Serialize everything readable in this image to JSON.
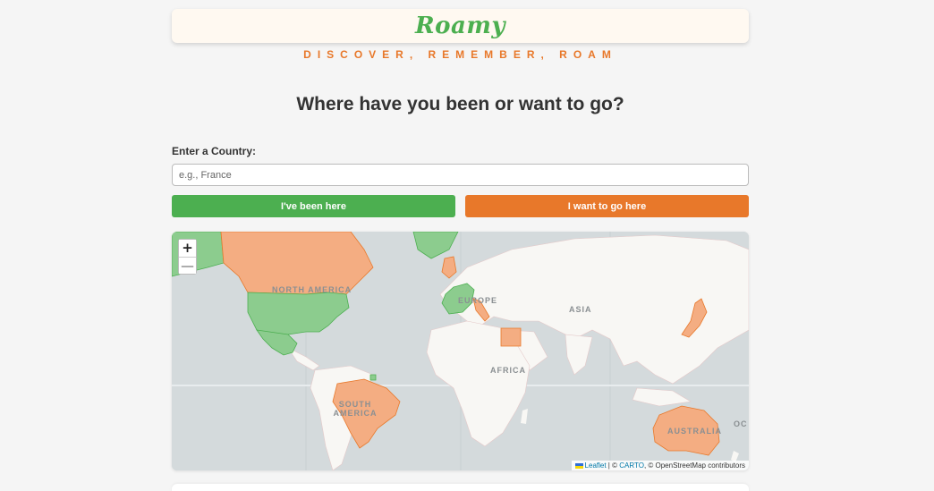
{
  "header": {
    "logo": "Roamy",
    "tagline": "DISCOVER, REMEMBER, ROAM"
  },
  "main": {
    "heading": "Where have you been or want to go?",
    "country_label": "Enter a Country:",
    "country_placeholder": "e.g., France",
    "country_value": "",
    "been_button": "I've been here",
    "want_button": "I want to go here"
  },
  "map": {
    "zoom_in": "+",
    "zoom_out": "—",
    "labels": {
      "north_america": "NORTH AMERICA",
      "europe": "EUROPE",
      "asia": "ASIA",
      "africa": "AFRICA",
      "south_america": "SOUTH AMERICA",
      "australia": "AUSTRALIA",
      "oceania_partial": "OC"
    },
    "attribution": {
      "leaflet": "Leaflet",
      "sep1": " | © ",
      "carto": "CARTO",
      "rest": ", © OpenStreetMap contributors"
    },
    "colors": {
      "visited": "#4caf50",
      "wishlist": "#e8782a",
      "land": "#f8f7f4",
      "water": "#d4dadc"
    },
    "visited_countries": [
      "United States",
      "Mexico",
      "France",
      "Germany",
      "Spain",
      "Portugal",
      "Greenland",
      "Alaska",
      "French Guiana"
    ],
    "wishlist_countries": [
      "Canada",
      "Brazil",
      "Australia",
      "Japan",
      "Italy",
      "United Kingdom",
      "Egypt"
    ]
  }
}
